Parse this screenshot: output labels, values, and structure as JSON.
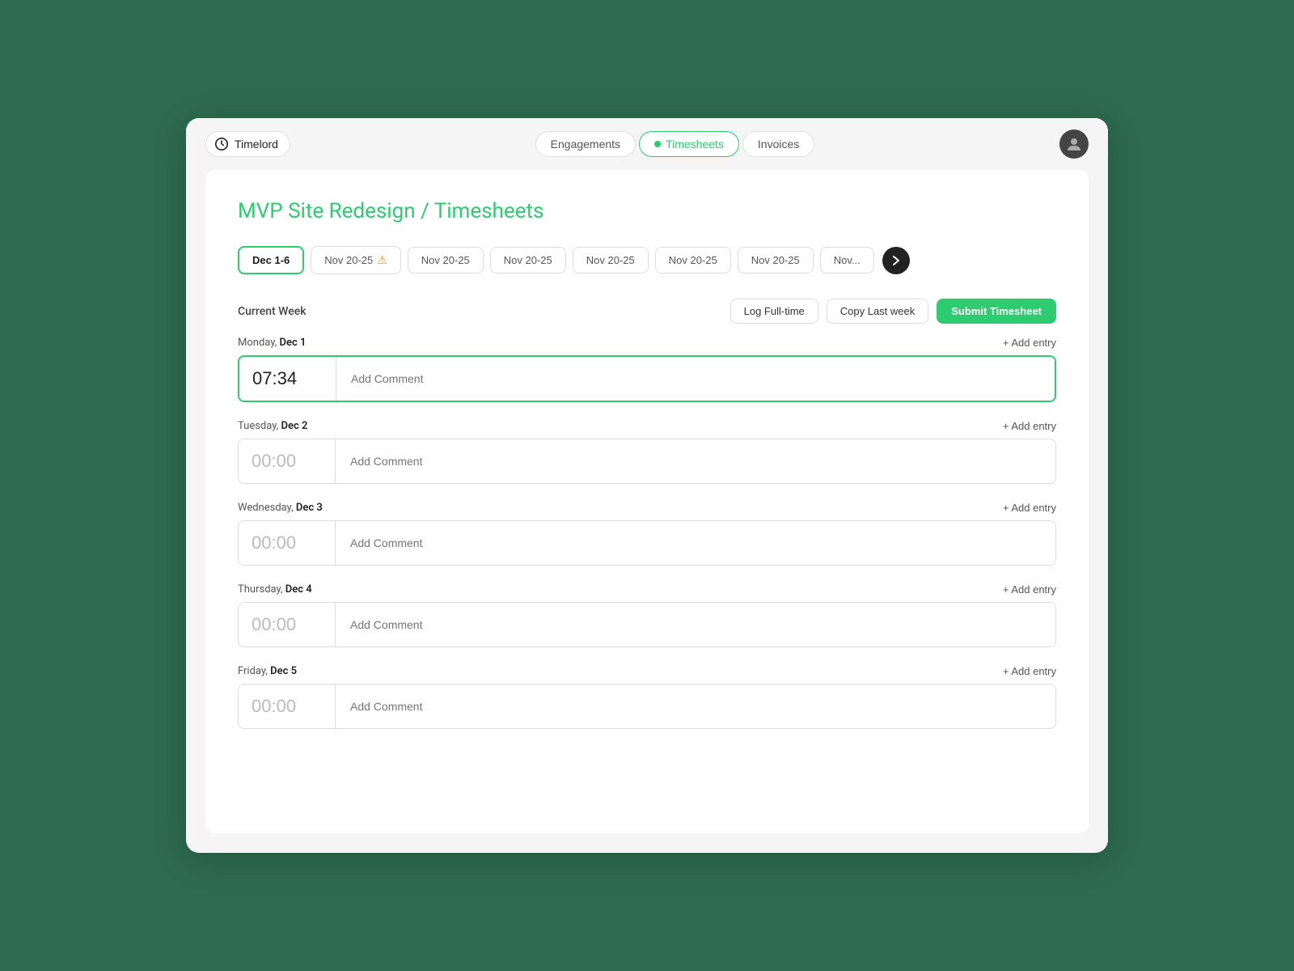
{
  "app": {
    "name": "Timelord"
  },
  "nav": {
    "tabs": [
      {
        "id": "engagements",
        "label": "Engagements",
        "active": false
      },
      {
        "id": "timesheets",
        "label": "Timesheets",
        "active": true
      },
      {
        "id": "invoices",
        "label": "Invoices",
        "active": false
      }
    ]
  },
  "page": {
    "project": "MVP Site Redesign",
    "section": "Timesheets",
    "breadcrumb_separator": " / "
  },
  "week_tabs": [
    {
      "id": "current",
      "label": "Dec 1-6",
      "active": true,
      "warning": false
    },
    {
      "id": "w1",
      "label": "Nov 20-25",
      "active": false,
      "warning": true
    },
    {
      "id": "w2",
      "label": "Nov 20-25",
      "active": false,
      "warning": false
    },
    {
      "id": "w3",
      "label": "Nov 20-25",
      "active": false,
      "warning": false
    },
    {
      "id": "w4",
      "label": "Nov 20-25",
      "active": false,
      "warning": false
    },
    {
      "id": "w5",
      "label": "Nov 20-25",
      "active": false,
      "warning": false
    },
    {
      "id": "w6",
      "label": "Nov 20-25",
      "active": false,
      "warning": false
    },
    {
      "id": "w7",
      "label": "Nov...",
      "active": false,
      "warning": false
    }
  ],
  "current_week": {
    "label": "Current Week",
    "actions": {
      "log_fulltime": "Log Full-time",
      "copy_last_week": "Copy Last week",
      "submit_timesheet": "Submit Timesheet"
    }
  },
  "days": [
    {
      "id": "monday",
      "label": "Monday,",
      "day_name": "Monday",
      "date": "Dec 1",
      "date_key": "Dec 1",
      "add_entry": "+ Add entry",
      "time_value": "07:34",
      "is_active": true,
      "comment_placeholder": "Add Comment"
    },
    {
      "id": "tuesday",
      "label": "Tuesday,",
      "day_name": "Tuesday",
      "date": "Dec 2",
      "date_key": "Dec 2",
      "add_entry": "+ Add entry",
      "time_value": "00:00",
      "is_active": false,
      "comment_placeholder": "Add Comment"
    },
    {
      "id": "wednesday",
      "label": "Wednesday,",
      "day_name": "Wednesday",
      "date": "Dec 3",
      "date_key": "Dec 3",
      "add_entry": "+ Add entry",
      "time_value": "00:00",
      "is_active": false,
      "comment_placeholder": "Add Comment"
    },
    {
      "id": "thursday",
      "label": "Thursday,",
      "day_name": "Thursday",
      "date": "Dec 4",
      "date_key": "Dec 4",
      "add_entry": "+ Add entry",
      "time_value": "00:00",
      "is_active": false,
      "comment_placeholder": "Add Comment"
    },
    {
      "id": "friday",
      "label": "Friday,",
      "day_name": "Friday",
      "date": "Dec 5",
      "date_key": "Dec 5",
      "add_entry": "+ Add entry",
      "time_value": "00:00",
      "is_active": false,
      "comment_placeholder": "Add Comment"
    }
  ],
  "colors": {
    "green": "#2ecc71",
    "dark": "#222222",
    "border": "#dddddd"
  }
}
